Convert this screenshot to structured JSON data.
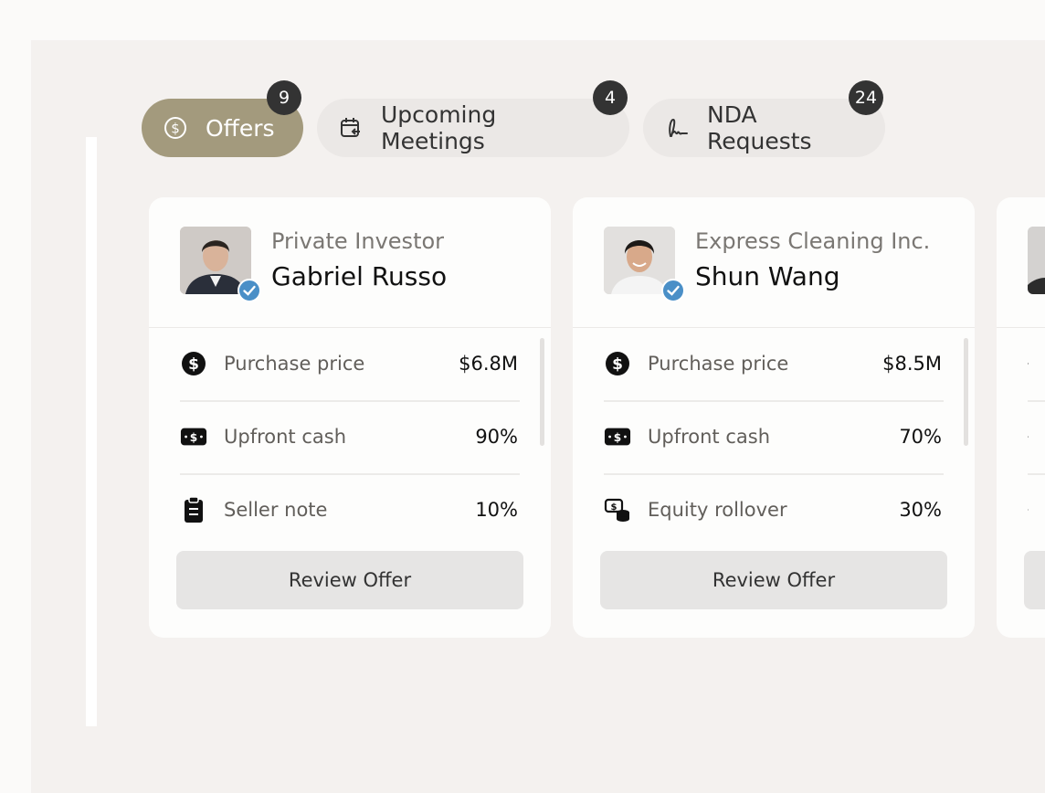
{
  "tabs": [
    {
      "label": "Offers",
      "count": "9",
      "icon": "dollar-circle-icon",
      "active": true
    },
    {
      "label": "Upcoming Meetings",
      "count": "4",
      "icon": "calendar-repeat-icon",
      "active": false
    },
    {
      "label": "NDA Requests",
      "count": "24",
      "icon": "signature-icon",
      "active": false
    }
  ],
  "offers": [
    {
      "company": "Private Investor",
      "name": "Gabriel Russo",
      "rows": [
        {
          "icon": "dollar-circle-icon",
          "label": "Purchase price",
          "value": "$6.8M"
        },
        {
          "icon": "cash-icon",
          "label": "Upfront cash",
          "value": "90%"
        },
        {
          "icon": "clipboard-icon",
          "label": "Seller note",
          "value": "10%"
        }
      ],
      "button": "Review Offer"
    },
    {
      "company": "Express Cleaning Inc.",
      "name": "Shun Wang",
      "rows": [
        {
          "icon": "dollar-circle-icon",
          "label": "Purchase price",
          "value": "$8.5M"
        },
        {
          "icon": "cash-icon",
          "label": "Upfront cash",
          "value": "70%"
        },
        {
          "icon": "equity-rollover-icon",
          "label": "Equity rollover",
          "value": "30%"
        }
      ],
      "button": "Review Offer"
    }
  ],
  "colors": {
    "active_tab": "#a39a7d",
    "badge": "#333333",
    "verified": "#4a8fc7"
  }
}
